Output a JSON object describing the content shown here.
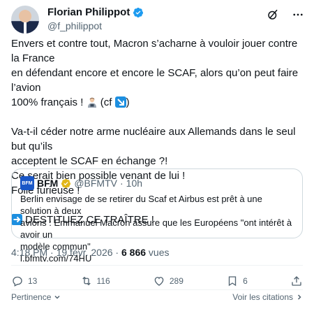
{
  "author": {
    "name": "Florian Philippot",
    "handle": "@f_philippot"
  },
  "tweet": {
    "line1": "Envers et contre tout, Macron s’acharne à vouloir jouer contre la France",
    "line2": "en défendant encore et encore le SCAF, alors qu’on peut faire l’avion",
    "line3": "100% français ! ",
    "line3_tail": " (cf ",
    "line3_end": ")",
    "line4": "Va-t-il céder notre arme nucléaire aux Allemands dans le seul but qu’ils",
    "line5": "acceptent le SCAF en échange ?!",
    "line6": "Ce serait bien possible venant de lui !",
    "line7": "Folie furieuse !",
    "line8": " DESTITUEZ CE TRAÎTRE !"
  },
  "quote": {
    "logo_text": "BFM",
    "name": "BFM",
    "handle": "@BFMTV",
    "separator": "·",
    "time": "10h",
    "body_line1": "Berlin envisage de se retirer du Scaf et Airbus est prêt à une solution à deux",
    "body_line2": "avions : Emmanuel Macron assure que les Européens \"ont intérêt à avoir un",
    "body_line3": "modèle commun\"",
    "link": "l.bfmtv.com/74HU"
  },
  "meta": {
    "time": "4:18 PM",
    "sep": " · ",
    "date": "19 févr. 2026",
    "sep2": " · ",
    "views_count": "6 866",
    "views_label": " vues"
  },
  "actions": {
    "replies": "13",
    "reposts": "116",
    "likes": "289",
    "bookmarks": "6"
  },
  "footer": {
    "left": "Pertinence",
    "right": "Voir les citations"
  },
  "colors": {
    "verified_blue": "#1d9bf0",
    "gold_badge": "#e2b719",
    "muted": "#536471",
    "text": "#0f1419"
  }
}
